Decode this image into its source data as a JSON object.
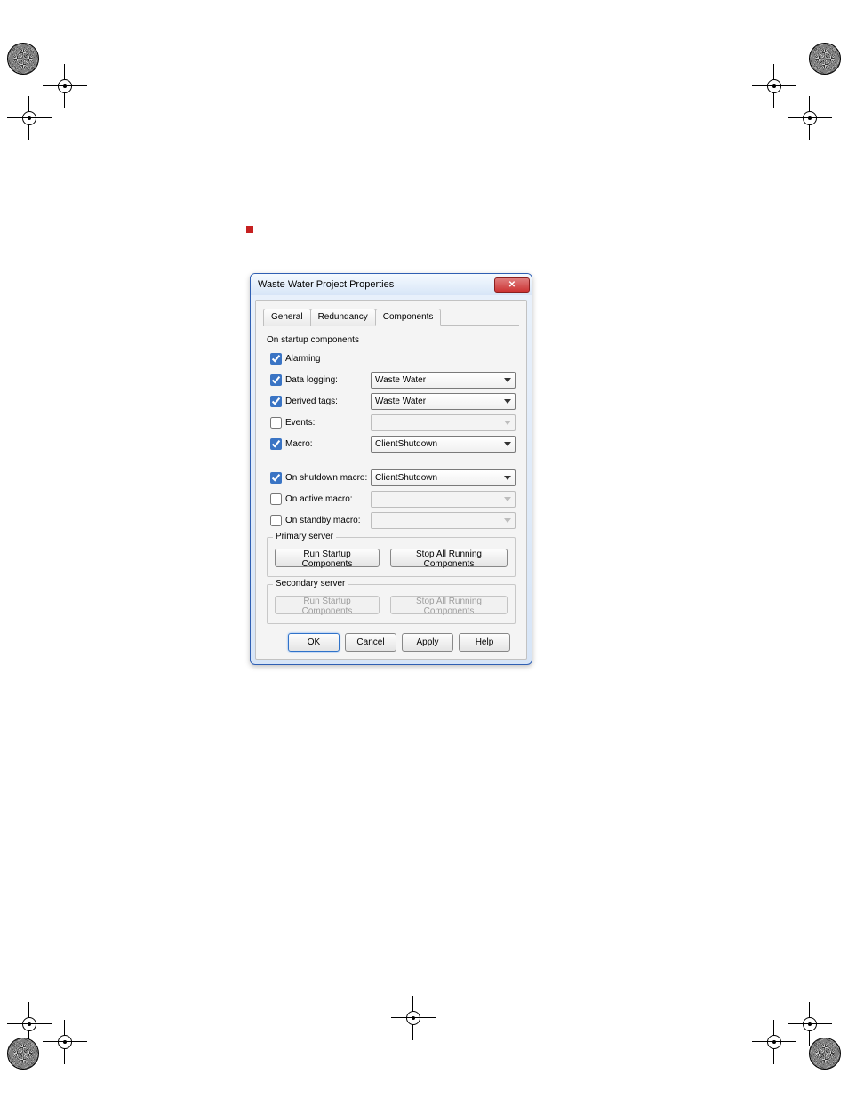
{
  "dialog": {
    "title": "Waste Water Project Properties",
    "close_glyph": "✕"
  },
  "tabs": {
    "general": "General",
    "redundancy": "Redundancy",
    "components": "Components"
  },
  "startup": {
    "section_label": "On startup components",
    "alarming": {
      "label": "Alarming"
    },
    "datalogging": {
      "label": "Data logging:",
      "value": "Waste Water"
    },
    "derivedtags": {
      "label": "Derived tags:",
      "value": "Waste Water"
    },
    "events": {
      "label": "Events:",
      "value": ""
    },
    "macro": {
      "label": "Macro:",
      "value": "ClientShutdown"
    }
  },
  "shutdown": {
    "onshutdown": {
      "label": "On shutdown macro:",
      "value": "ClientShutdown"
    },
    "onactive": {
      "label": "On active macro:",
      "value": ""
    },
    "onstandby": {
      "label": "On standby macro:",
      "value": ""
    }
  },
  "primary": {
    "legend": "Primary server",
    "run": "Run Startup Components",
    "stop": "Stop All Running Components"
  },
  "secondary": {
    "legend": "Secondary server",
    "run": "Run Startup Components",
    "stop": "Stop All Running Components"
  },
  "buttons": {
    "ok": "OK",
    "cancel": "Cancel",
    "apply": "Apply",
    "help": "Help"
  }
}
